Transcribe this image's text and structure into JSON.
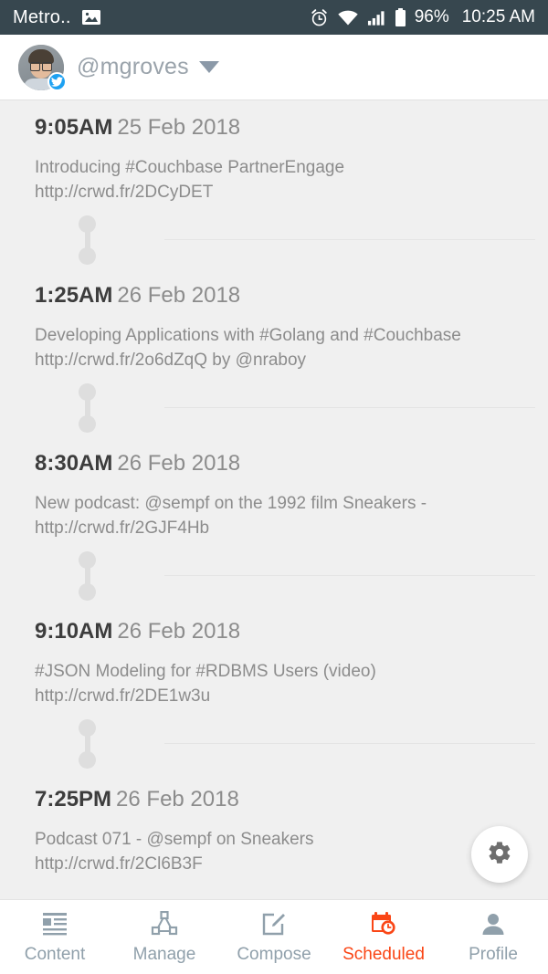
{
  "status_bar": {
    "carrier": "Metro..",
    "photo_icon": "image-icon",
    "alarm_icon": "alarm-clock-icon",
    "wifi_icon": "wifi-icon",
    "signal_icon": "cellular-signal-icon",
    "battery_icon": "battery-icon",
    "battery_percent": "96%",
    "time": "10:25 AM",
    "background": "#37474f",
    "foreground": "#ffffff"
  },
  "header": {
    "avatar": "user-avatar",
    "network_badge": "twitter-badge-icon",
    "handle": "@mgroves",
    "dropdown_icon": "chevron-down-icon"
  },
  "timeline": {
    "posts": [
      {
        "time": "9:05AM",
        "date": "25 Feb 2018",
        "lines": [
          "Introducing #Couchbase PartnerEngage",
          "http://crwd.fr/2DCyDET"
        ]
      },
      {
        "time": "1:25AM",
        "date": "26 Feb 2018",
        "lines": [
          "Developing Applications with #Golang and #Couchbase",
          "http://crwd.fr/2o6dZqQ by @nraboy"
        ]
      },
      {
        "time": "8:30AM",
        "date": "26 Feb 2018",
        "lines": [
          "New podcast: @sempf on the 1992 film Sneakers -",
          "http://crwd.fr/2GJF4Hb"
        ]
      },
      {
        "time": "9:10AM",
        "date": "26 Feb 2018",
        "lines": [
          "#JSON Modeling for #RDBMS Users (video)",
          "http://crwd.fr/2DE1w3u"
        ]
      },
      {
        "time": "7:25PM",
        "date": "26 Feb 2018",
        "lines": [
          "Podcast 071 - @sempf on Sneakers",
          "http://crwd.fr/2Cl6B3F"
        ]
      }
    ]
  },
  "fab": {
    "icon": "gear-icon"
  },
  "bottom_nav": {
    "active_color": "#fa4616",
    "inactive_color": "#90a0ab",
    "items": [
      {
        "label": "Content",
        "icon": "article-list-icon",
        "active": false
      },
      {
        "label": "Manage",
        "icon": "network-nodes-icon",
        "active": false
      },
      {
        "label": "Compose",
        "icon": "pencil-square-icon",
        "active": false
      },
      {
        "label": "Scheduled",
        "icon": "calendar-clock-icon",
        "active": true
      },
      {
        "label": "Profile",
        "icon": "person-icon",
        "active": false
      }
    ]
  }
}
